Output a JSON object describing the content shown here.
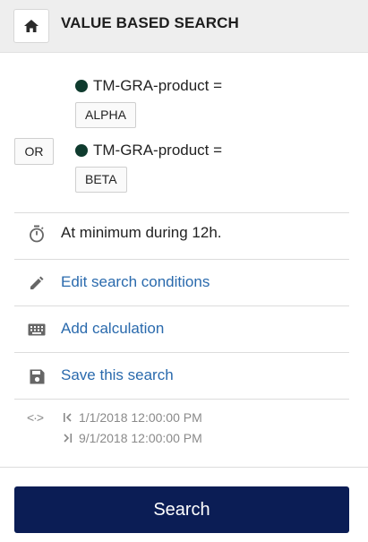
{
  "header": {
    "title": "VALUE BASED SEARCH",
    "home_icon": "home-icon"
  },
  "conditions": {
    "operator": "OR",
    "items": [
      {
        "field": "TM-GRA-product =",
        "value": "ALPHA",
        "dot_color": "#0f3b2e"
      },
      {
        "field": "TM-GRA-product =",
        "value": "BETA",
        "dot_color": "#0f3b2e"
      }
    ]
  },
  "duration": {
    "icon": "timer-icon",
    "text": "At minimum during 12h."
  },
  "actions": [
    {
      "icon": "pencil-icon",
      "label": "Edit search conditions"
    },
    {
      "icon": "keyboard-icon",
      "label": "Add calculation"
    },
    {
      "icon": "save-icon",
      "label": "Save this search"
    }
  ],
  "time_range": {
    "icon": "range-icon",
    "start": "1/1/2018 12:00:00 PM",
    "end": "9/1/2018 12:00:00 PM"
  },
  "search_button": {
    "label": "Search"
  },
  "colors": {
    "accent": "#0b1d55",
    "link": "#2a6aad",
    "dot": "#0f3b2e"
  }
}
